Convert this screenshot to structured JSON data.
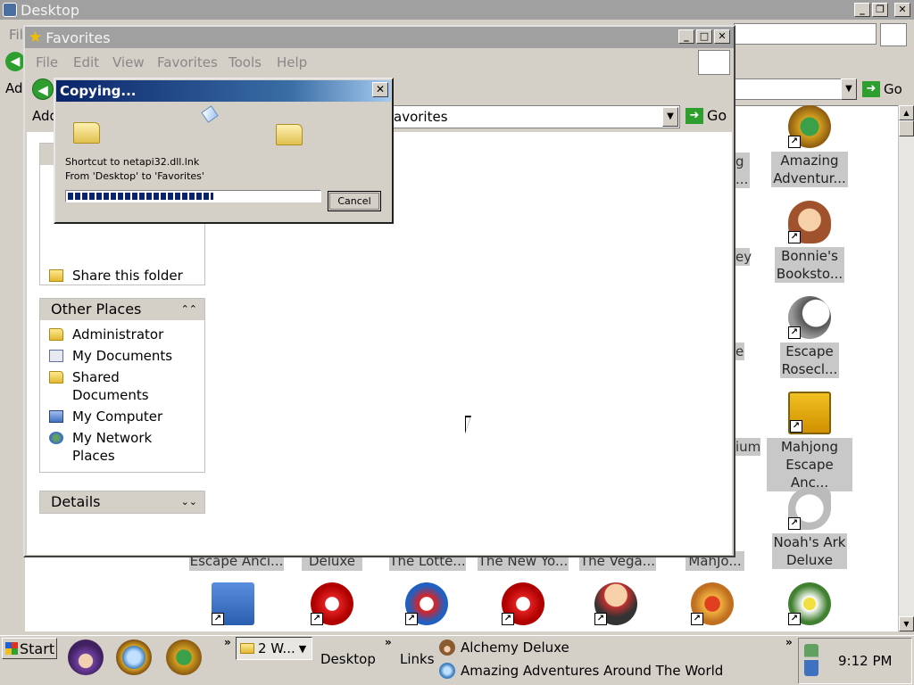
{
  "desktop_window": {
    "title": "Desktop",
    "menu_partial": "Fil",
    "address_label_partial": "Ad",
    "go_label": "Go",
    "title_icon": "desktop-icon"
  },
  "right_icons": [
    {
      "name": "amazing-adventures-shortcut",
      "label1": "Amazing",
      "label2": "Adventur...",
      "icon": "compass-icon"
    },
    {
      "name": "bonnies-bookstore-shortcut",
      "label1": "Bonnie's",
      "label2": "Booksto...",
      "icon": "face-icon"
    },
    {
      "name": "escape-rosecliff-shortcut",
      "label1": "Escape",
      "label2": "Rosecl...",
      "icon": "moon-icon"
    },
    {
      "name": "mahjong-escape-shortcut",
      "label1": "Mahjong",
      "label2": "Escape Anc...",
      "icon": "mahjong-icon"
    },
    {
      "name": "noahs-ark-shortcut",
      "label1": "Noah's Ark",
      "label2": "Deluxe",
      "icon": "dove-icon"
    }
  ],
  "partial_labels": [
    "g",
    "...",
    "ey",
    "e",
    "ium"
  ],
  "bottom_row_labels": [
    "Escape Anci...",
    "Deluxe",
    "The Lotte...",
    "The New Yo...",
    "The Vega...",
    "MahJo..."
  ],
  "favorites_window": {
    "title": "Favorites",
    "menu": [
      "File",
      "Edit",
      "View",
      "Favorites",
      "Tools",
      "Help"
    ],
    "address_label": "Add",
    "address_value": "avorites",
    "go_label": "Go",
    "share_folder": "Share this folder",
    "other_places_title": "Other Places",
    "other_places": [
      {
        "label": "Administrator",
        "icon": "folder-icon"
      },
      {
        "label": "My Documents",
        "icon": "documents-icon"
      },
      {
        "label": "Shared\nDocuments",
        "icon": "folder-icon"
      },
      {
        "label": "My Computer",
        "icon": "computer-icon"
      },
      {
        "label": "My Network\nPlaces",
        "icon": "network-icon"
      }
    ],
    "details_title": "Details"
  },
  "copy_dialog": {
    "title": "Copying...",
    "file_line": "Shortcut to netapi32.dll.lnk",
    "from_line": "From 'Desktop' to 'Favorites'",
    "progress": 0.58,
    "cancel_label": "Cancel"
  },
  "taskbar": {
    "start_label": "Start",
    "task_button": "2 W...",
    "desktop_label": "Desktop",
    "links_label": "Links",
    "link_items": [
      "Alchemy Deluxe",
      "Amazing Adventures Around The World"
    ],
    "time": "9:12 PM"
  },
  "colors": {
    "dialog_title_start": "#0a246a",
    "dialog_title_end": "#a6caf0",
    "progress_fill": "#0a246a",
    "inactive_title": "#a0a0a0",
    "go_green": "#2e9e2e"
  }
}
